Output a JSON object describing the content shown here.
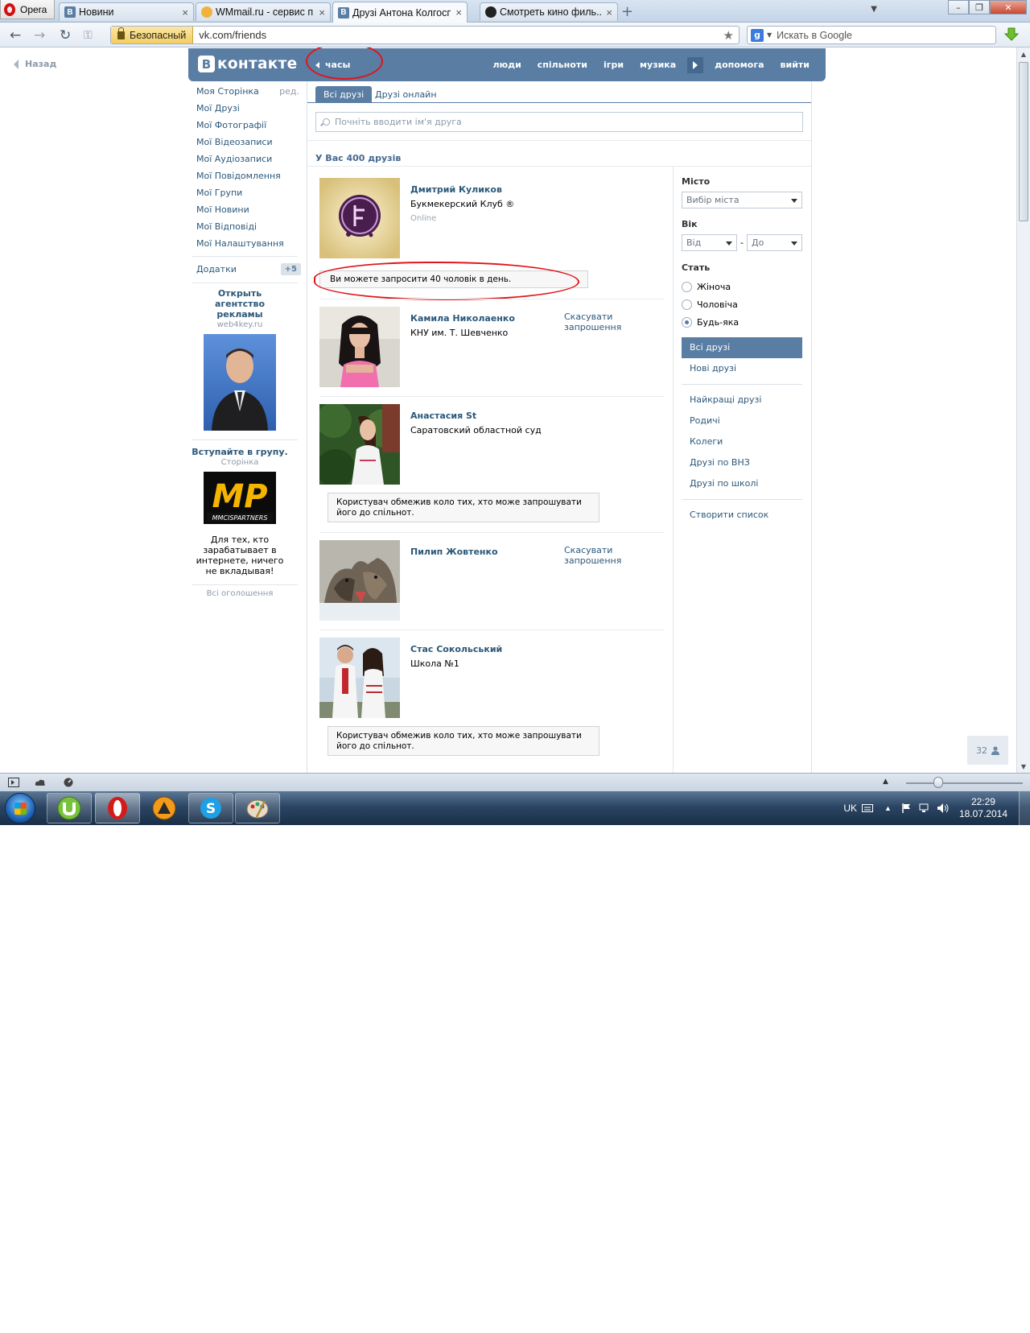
{
  "browser": {
    "menu_label": "Opera",
    "tabs": [
      {
        "title": "Новини",
        "favicon": "vk-icon"
      },
      {
        "title": "WMmail.ru - сервис п...",
        "favicon": "coin-icon"
      },
      {
        "title": "Друзі Антона Колгосп...",
        "favicon": "vk-icon",
        "active": true
      },
      {
        "title": "Смотреть кино филь...",
        "favicon": "mask-icon"
      }
    ],
    "secure_label": "Безопасный",
    "url": "vk.com/friends",
    "search_placeholder": "Искать в Google",
    "search_engine_letter": "g"
  },
  "page": {
    "back_label": "Назад",
    "logo_letter": "В",
    "logo_text": "контакте",
    "app_nav_label": "часы",
    "top_menu": [
      "люди",
      "спільноти",
      "ігри",
      "музика",
      "допомога",
      "вийти"
    ],
    "left_menu": [
      {
        "label": "Моя Сторінка",
        "extra": "ред."
      },
      {
        "label": "Мої Друзі"
      },
      {
        "label": "Мої Фотографії"
      },
      {
        "label": "Мої Відеозаписи"
      },
      {
        "label": "Мої Аудіозаписи"
      },
      {
        "label": "Мої Повідомлення"
      },
      {
        "label": "Мої Групи"
      },
      {
        "label": "Мої Новини"
      },
      {
        "label": "Мої Відповіді"
      },
      {
        "label": "Мої Налаштування"
      }
    ],
    "apps": {
      "label": "Додатки",
      "badge": "+5"
    },
    "ad1": {
      "title": "Открыть агентство рекламы",
      "domain": "web4key.ru"
    },
    "ad2": {
      "title": "Вступайте в групу.",
      "domain": "Сторінка",
      "logo_text": "MP",
      "logo_caption": "MMCISPARTNERS",
      "text": "Для тех, кто зарабатывает в интернете, ничего не вкладывая!"
    },
    "all_ads": "Всі оголошення",
    "tabs": [
      "Всі друзі",
      "Друзі онлайн"
    ],
    "search_placeholder": "Почніть вводити ім'я друга",
    "friends_count": "У Вас 400 друзів",
    "friends": [
      {
        "name": "Дмитрий Куликов",
        "sub": "Букмекерский Клуб ®",
        "status": "Online",
        "action": ""
      },
      {
        "name": "Камила Николаенко",
        "sub": "КНУ им. Т. Шевченко",
        "status": "",
        "action": "Скасувати запрошення"
      },
      {
        "name": "Анастасия St",
        "sub": "Саратовский областной суд",
        "status": "",
        "action": ""
      },
      {
        "name": "Пилип Жовтенко",
        "sub": "",
        "status": "",
        "action": "Скасувати запрошення"
      },
      {
        "name": "Стас Сокольський",
        "sub": "Школа №1",
        "status": "",
        "action": ""
      }
    ],
    "notice_limit": "Ви можете запросити 40 чоловік в день.",
    "notice_restricted": "Користувач обмежив коло тих, хто може запрошувати його до спільнот.",
    "filters": {
      "city_label": "Місто",
      "city_value": "Вибір міста",
      "age_label": "Вік",
      "age_from": "Від",
      "age_dash": "-",
      "age_to": "До",
      "sex_label": "Стать",
      "sex_options": [
        "Жіноча",
        "Чоловіча",
        "Будь-яка"
      ],
      "sex_selected": 2
    },
    "lists": [
      "Всі друзі",
      "Нові друзі",
      "Найкращі друзі",
      "Родичі",
      "Колеги",
      "Друзі по ВНЗ",
      "Друзі по школі",
      "Створити список"
    ],
    "chat_count": "32"
  },
  "taskbar": {
    "lang": "UK",
    "time": "22:29",
    "date": "18.07.2014"
  },
  "colors": {
    "vk_blue": "#597da3",
    "vk_link": "#2b587a",
    "annotation_red": "#e0151a"
  }
}
